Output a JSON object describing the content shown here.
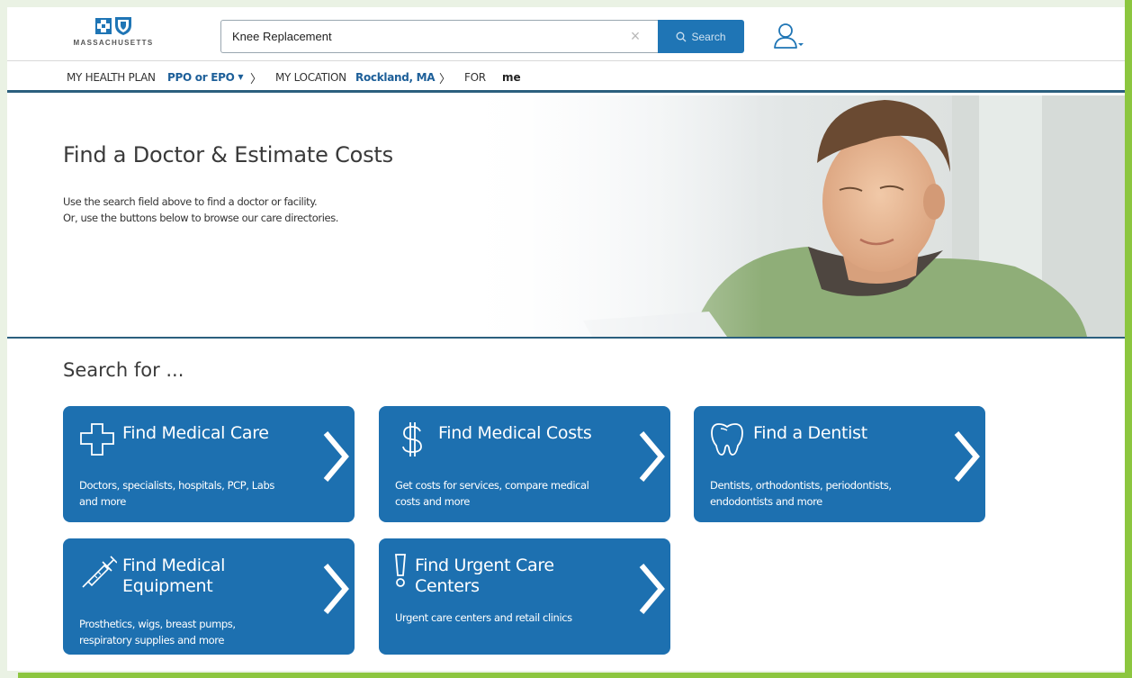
{
  "brand": {
    "logo_text": "MASSACHUSETTS"
  },
  "search": {
    "value": "Knee Replacement",
    "placeholder": "",
    "button_label": "Search"
  },
  "context": {
    "plan_label": "MY HEALTH PLAN",
    "plan_value": "PPO or EPO",
    "location_label": "MY LOCATION",
    "location_value": "Rockland, MA",
    "for_label": "FOR",
    "for_value": "me"
  },
  "hero": {
    "title": "Find a Doctor & Estimate Costs",
    "line1": "Use the search field above to find a doctor or facility.",
    "line2": "Or, use the buttons below to browse our care directories."
  },
  "section_title": "Search for ...",
  "cards": [
    {
      "title": "Find Medical Care",
      "desc1": "Doctors, specialists, hospitals, PCP, Labs",
      "desc2": "and more",
      "icon": "medical-cross-icon"
    },
    {
      "title": "Find Medical Costs",
      "desc1": "Get costs for services, compare medical",
      "desc2": "costs and more",
      "icon": "dollar-icon"
    },
    {
      "title": "Find a Dentist",
      "desc1": "Dentists, orthodontists, periodontists,",
      "desc2": "endodontists and more",
      "icon": "tooth-icon"
    },
    {
      "title1": "Find Medical",
      "title2": "Equipment",
      "desc1": "Prosthetics, wigs, breast pumps,",
      "desc2": "respiratory supplies and more",
      "icon": "syringe-icon"
    },
    {
      "title1": "Find Urgent Care",
      "title2": "Centers",
      "desc1": "Urgent care centers and retail clinics",
      "icon": "exclamation-icon"
    }
  ],
  "colors": {
    "accent": "#1d70b0",
    "link": "#1d5f99",
    "border_green": "#8cc63f"
  }
}
